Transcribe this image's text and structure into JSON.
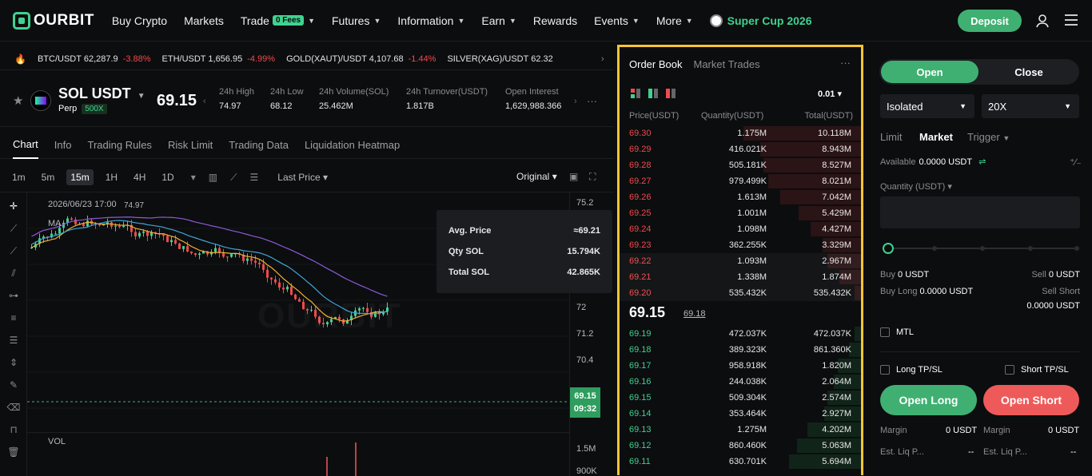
{
  "nav": {
    "logo": "OURBIT",
    "items": [
      "Buy Crypto",
      "Markets",
      "Trade",
      "Futures",
      "Information",
      "Earn",
      "Rewards",
      "Events",
      "More"
    ],
    "fees_badge": "0 Fees",
    "supercup": "Super Cup 2026",
    "deposit": "Deposit"
  },
  "ticker": [
    {
      "pair": "BTC/USDT",
      "price": "62,287.9",
      "change": "-3.88%"
    },
    {
      "pair": "ETH/USDT",
      "price": "1,656.95",
      "change": "-4.99%"
    },
    {
      "pair": "GOLD(XAUT)/USDT",
      "price": "4,107.68",
      "change": "-1.44%"
    },
    {
      "pair": "SILVER(XAG)/USDT",
      "price": "62.32",
      "change": ""
    }
  ],
  "symbol": {
    "name": "SOL USDT",
    "perp": "Perp",
    "leverage": "500X",
    "price": "69.15",
    "stats": [
      {
        "label": "24h High",
        "value": "74.97"
      },
      {
        "label": "24h Low",
        "value": "68.12"
      },
      {
        "label": "24h Volume(SOL)",
        "value": "25.462M"
      },
      {
        "label": "24h Turnover(USDT)",
        "value": "1.817B"
      },
      {
        "label": "Open Interest",
        "value": "1,629,988.366"
      }
    ]
  },
  "tabs": [
    "Chart",
    "Info",
    "Trading Rules",
    "Risk Limit",
    "Trading Data",
    "Liquidation Heatmap"
  ],
  "toolbar": {
    "timeframes": [
      "1m",
      "5m",
      "15m",
      "1H",
      "4H",
      "1D"
    ],
    "active_timeframe": "15m",
    "last_price": "Last Price",
    "original": "Original"
  },
  "chart": {
    "date": "2026/06/23 17:00",
    "ma": "MA",
    "high_label": "74.97",
    "vol": "VOL",
    "watermark": "OURBIT",
    "y_labels": [
      "75.2",
      "72",
      "71.2",
      "70.4"
    ],
    "vol_labels": [
      "1.5M",
      "900K"
    ],
    "price_tag": "69.15",
    "countdown": "09:32",
    "tooltip": [
      {
        "label": "Avg. Price",
        "value": "≈69.21"
      },
      {
        "label": "Qty SOL",
        "value": "15.794K"
      },
      {
        "label": "Total SOL",
        "value": "42.865K"
      }
    ]
  },
  "orderbook": {
    "tab_active": "Order Book",
    "tab_other": "Market Trades",
    "tick": "0.01",
    "columns": [
      "Price(USDT)",
      "Quantity(USDT)",
      "Total(USDT)"
    ],
    "asks": [
      {
        "price": "69.30",
        "qty": "1.175M",
        "total": "10.118M",
        "depth": 0.7
      },
      {
        "price": "69.29",
        "qty": "416.021K",
        "total": "8.943M",
        "depth": 0.6
      },
      {
        "price": "69.28",
        "qty": "505.181K",
        "total": "8.527M",
        "depth": 0.58
      },
      {
        "price": "69.27",
        "qty": "979.499K",
        "total": "8.021M",
        "depth": 0.55
      },
      {
        "price": "69.26",
        "qty": "1.613M",
        "total": "7.042M",
        "depth": 0.48
      },
      {
        "price": "69.25",
        "qty": "1.001M",
        "total": "5.429M",
        "depth": 0.37
      },
      {
        "price": "69.24",
        "qty": "1.098M",
        "total": "4.427M",
        "depth": 0.3
      },
      {
        "price": "69.23",
        "qty": "362.255K",
        "total": "3.329M",
        "depth": 0.23
      },
      {
        "price": "69.22",
        "qty": "1.093M",
        "total": "2.967M",
        "depth": 0.2
      },
      {
        "price": "69.21",
        "qty": "1.338M",
        "total": "1.874M",
        "depth": 0.13
      },
      {
        "price": "69.20",
        "qty": "535.432K",
        "total": "535.432K",
        "depth": 0.04
      }
    ],
    "mid_price": "69.15",
    "mark_price": "69.18",
    "bids": [
      {
        "price": "69.19",
        "qty": "472.037K",
        "total": "472.037K",
        "depth": 0.04
      },
      {
        "price": "69.18",
        "qty": "389.323K",
        "total": "861.360K",
        "depth": 0.07
      },
      {
        "price": "69.17",
        "qty": "958.918K",
        "total": "1.820M",
        "depth": 0.14
      },
      {
        "price": "69.16",
        "qty": "244.038K",
        "total": "2.064M",
        "depth": 0.16
      },
      {
        "price": "69.15",
        "qty": "509.304K",
        "total": "2.574M",
        "depth": 0.2
      },
      {
        "price": "69.14",
        "qty": "353.464K",
        "total": "2.927M",
        "depth": 0.22
      },
      {
        "price": "69.13",
        "qty": "1.275M",
        "total": "4.202M",
        "depth": 0.32
      },
      {
        "price": "69.12",
        "qty": "860.460K",
        "total": "5.063M",
        "depth": 0.38
      },
      {
        "price": "69.11",
        "qty": "630.701K",
        "total": "5.694M",
        "depth": 0.43
      }
    ]
  },
  "panel": {
    "open": "Open",
    "close": "Close",
    "margin_mode": "Isolated",
    "leverage": "20X",
    "order_types": [
      "Limit",
      "Market",
      "Trigger"
    ],
    "active_order_type": "Market",
    "available_label": "Available",
    "available_value": "0.0000 USDT",
    "qty_label": "Quantity (USDT)",
    "buy_label": "Buy",
    "buy_value": "0 USDT",
    "sell_label": "Sell",
    "sell_value": "0 USDT",
    "buy_long_label": "Buy Long",
    "buy_long_value": "0.0000 USDT",
    "sell_short_label": "Sell Short",
    "sell_short_value": "0.0000 USDT",
    "mtl": "MTL",
    "long_tpsl": "Long TP/SL",
    "short_tpsl": "Short TP/SL",
    "open_long": "Open Long",
    "open_short": "Open Short",
    "margin_label": "Margin",
    "margin_value": "0 USDT",
    "est_liq_label": "Est. Liq P...",
    "est_liq_value": "--"
  },
  "colors": {
    "accent": "#3fb072",
    "up": "#3fd28f",
    "down": "#f04a4a",
    "highlight": "#f5c531"
  }
}
